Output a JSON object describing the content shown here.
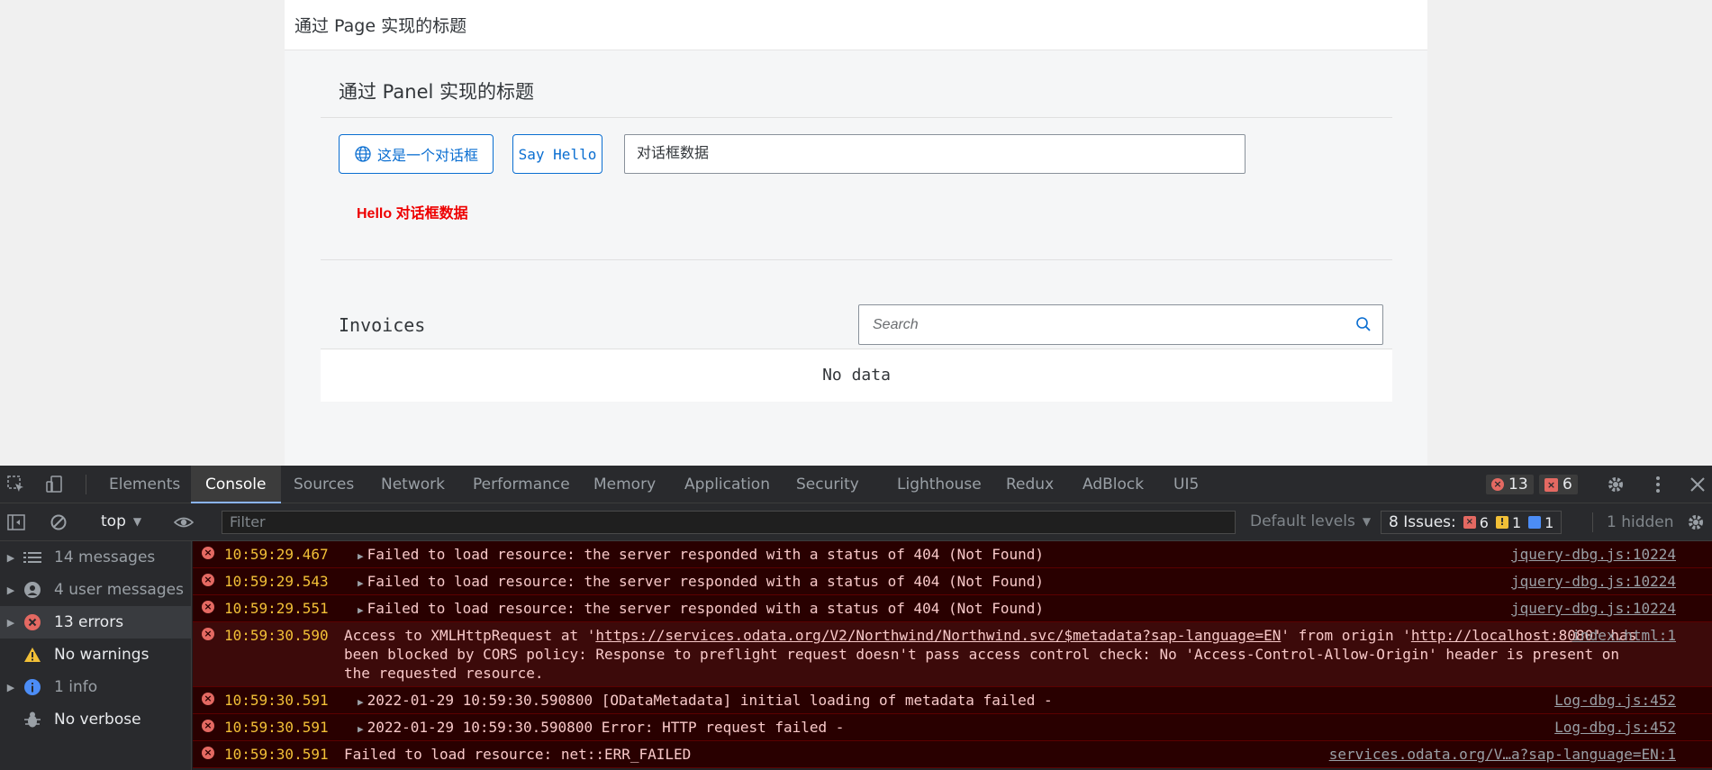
{
  "page": {
    "header_title": "通过 Page 实现的标题",
    "panel_title": "通过 Panel 实现的标题",
    "dialog_button": "这是一个对话框",
    "hello_button": "Say Hello",
    "dialog_input_value": "对话框数据",
    "hello_text": "Hello 对话框数据",
    "invoices_title": "Invoices",
    "search_placeholder": "Search",
    "no_data": "No data",
    "accent_color": "#0a6ed1",
    "hello_color": "#e00000"
  },
  "devtools": {
    "tabs": [
      "Elements",
      "Console",
      "Sources",
      "Network",
      "Performance",
      "Memory",
      "Application",
      "Security",
      "Lighthouse",
      "Redux",
      "AdBlock",
      "UI5"
    ],
    "active_tab": "Console",
    "error_count": "13",
    "issue_count_badge": "6",
    "context": "top",
    "filter_placeholder": "Filter",
    "default_levels": "Default levels",
    "issues_label": "8 Issues:",
    "issues_errors": "6",
    "issues_warnings": "1",
    "issues_info": "1",
    "hidden": "1 hidden",
    "sidebar": [
      {
        "label": "14 messages",
        "icon": "list-icon"
      },
      {
        "label": "4 user messages",
        "icon": "user-icon"
      },
      {
        "label": "13 errors",
        "icon": "error-icon"
      },
      {
        "label": "No warnings",
        "icon": "warning-icon"
      },
      {
        "label": "1 info",
        "icon": "info-icon"
      },
      {
        "label": "No verbose",
        "icon": "bug-icon"
      }
    ],
    "messages": [
      {
        "time": "10:59:29.467",
        "text": "Failed to load resource: the server responded with a status of 404 (Not Found)",
        "source": "jquery-dbg.js:10224"
      },
      {
        "time": "10:59:29.543",
        "text": "Failed to load resource: the server responded with a status of 404 (Not Found)",
        "source": "jquery-dbg.js:10224"
      },
      {
        "time": "10:59:29.551",
        "text": "Failed to load resource: the server responded with a status of 404 (Not Found)",
        "source": "jquery-dbg.js:10224"
      },
      {
        "time": "10:59:30.590",
        "text_pre": "Access to XMLHttpRequest at '",
        "url": "https://services.odata.org/V2/Northwind/Northwind.svc/$metadata?sap-language=EN",
        "text_mid": "' from origin '",
        "origin": "http://localhost:8080",
        "text_post": "' has been blocked by CORS policy: Response to preflight request doesn't pass access control check: No 'Access-Control-Allow-Origin' header is present on the requested resource.",
        "source": "index.html:1"
      },
      {
        "time": "10:59:30.591",
        "text": "2022-01-29 10:59:30.590800 [ODataMetadata] initial loading of metadata failed -",
        "source": "Log-dbg.js:452"
      },
      {
        "time": "10:59:30.591",
        "text": "2022-01-29 10:59:30.590800 Error: HTTP request failed -",
        "source": "Log-dbg.js:452"
      },
      {
        "time": "10:59:30.591",
        "text": "Failed to load resource: net::ERR_FAILED",
        "source": "services.odata.org/V…a?sap-language=EN:1"
      }
    ]
  }
}
